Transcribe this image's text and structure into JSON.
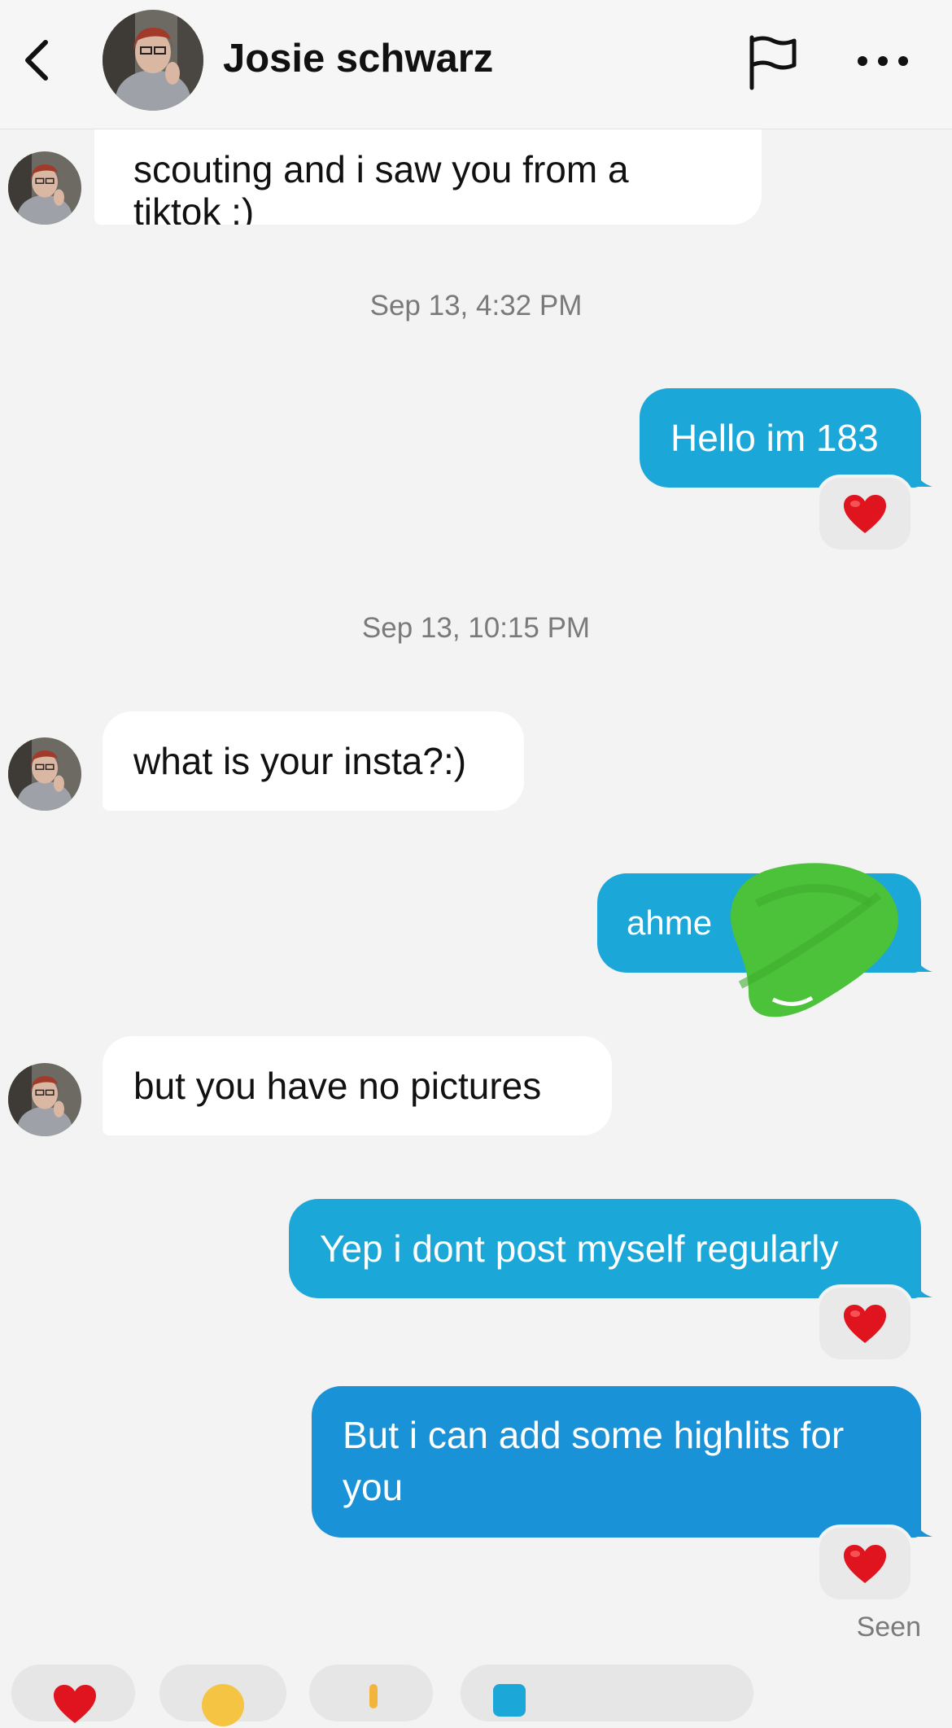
{
  "header": {
    "contact_name": "Josie schwarz"
  },
  "icons": {
    "back": "chevron-left-icon",
    "report": "flag-icon",
    "more": "more-horizontal-icon",
    "reaction": "heart-icon"
  },
  "colors": {
    "outgoing_bubble": "#1ba7d8",
    "incoming_bubble": "#ffffff",
    "background": "#f3f3f4",
    "reaction_heart": "#e0141f",
    "redaction_scribble": "#4cc13a"
  },
  "messages": [
    {
      "sender": "Josie schwarz",
      "direction": "incoming",
      "text_partial_top": "scouting and i saw you from a",
      "text": "tiktok :)"
    },
    {
      "timestamp": "Sep 13, 4:32 PM"
    },
    {
      "direction": "outgoing",
      "text": "Hello im 183",
      "reaction": "❤️"
    },
    {
      "timestamp": "Sep 13, 10:15 PM"
    },
    {
      "direction": "incoming",
      "text": "what is your insta?:)"
    },
    {
      "direction": "outgoing",
      "text": "ahme",
      "redacted": true
    },
    {
      "direction": "incoming",
      "text": "but you have no pictures"
    },
    {
      "direction": "outgoing",
      "text": "Yep i dont post myself regularly",
      "reaction": "❤️"
    },
    {
      "direction": "outgoing",
      "text_line1": "But i can add some highlits for",
      "text_line2": "you",
      "reaction": "❤️"
    }
  ],
  "status": {
    "seen": "Seen"
  }
}
